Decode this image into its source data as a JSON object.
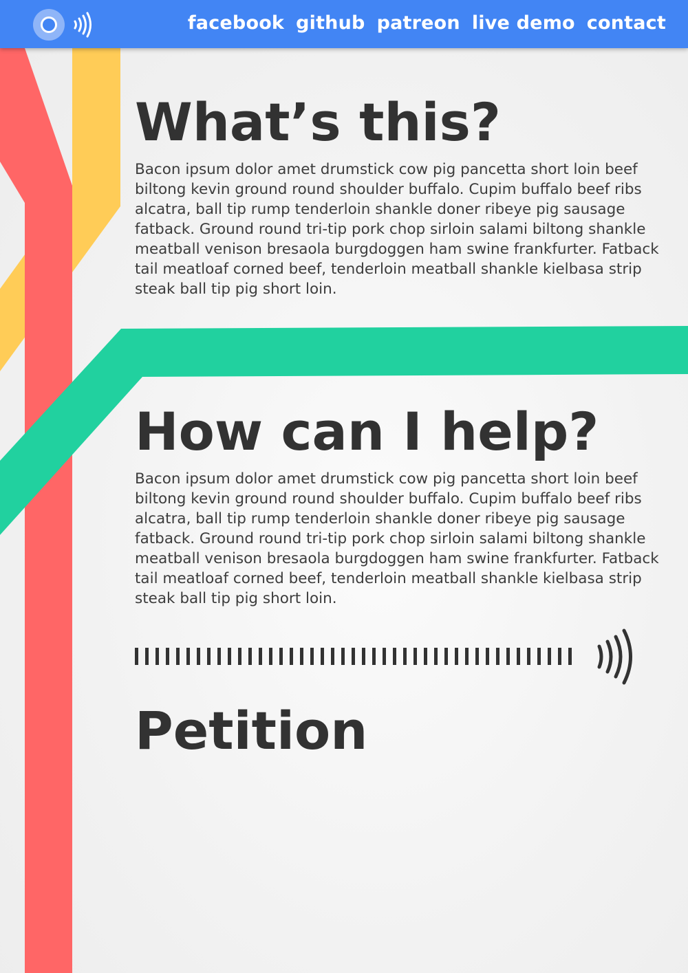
{
  "header": {
    "brand_color": "#4285f4",
    "logo_icon": "ring-logo-icon",
    "waves_icon": "signal-waves-icon",
    "nav": [
      "facebook",
      "github",
      "patreon",
      "live demo",
      "contact"
    ]
  },
  "sections": [
    {
      "heading": "What’s this?",
      "body": "Bacon ipsum dolor amet drumstick cow pig pancetta short loin beef biltong kevin ground round shoulder buffalo. Cupim buffalo beef ribs alcatra, ball tip rump tenderloin shankle doner ribeye pig sausage fatback. Ground round tri-tip pork chop sirloin salami biltong shankle meatball venison bresaola burgdoggen ham swine frankfurter. Fatback tail meatloaf corned beef, tenderloin meatball shankle kielbasa strip steak ball tip pig short loin."
    },
    {
      "heading": "How can I help?",
      "body": "Bacon ipsum dolor amet drumstick cow pig pancetta short loin beef biltong kevin ground round shoulder buffalo. Cupim buffalo beef ribs alcatra, ball tip rump tenderloin shankle doner ribeye pig sausage fatback. Ground round tri-tip pork chop sirloin salami biltong shankle meatball venison bresaola burgdoggen ham swine frankfurter. Fatback tail meatloaf corned beef, tenderloin meatball shankle kielbasa strip steak ball tip pig short loin."
    },
    {
      "heading": "Petition"
    }
  ],
  "decoration": {
    "line_colors": {
      "red": "#ff6666",
      "yellow": "#ffcc57",
      "green": "#21d19f"
    },
    "divider_icon": "signal-waves-icon",
    "divider_bar_count": 43,
    "text_color": "#323232"
  }
}
